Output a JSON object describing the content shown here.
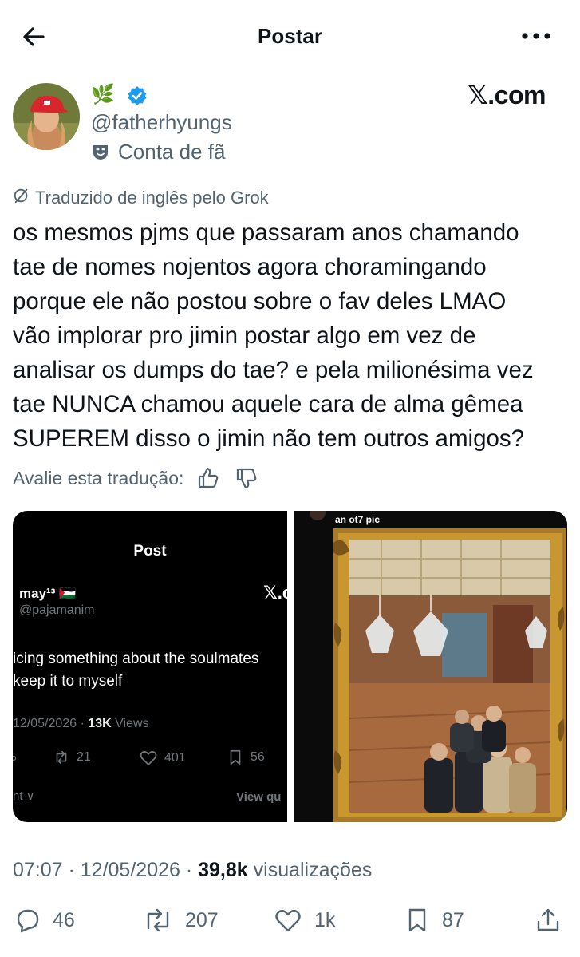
{
  "topbar": {
    "title": "Postar"
  },
  "author": {
    "emoji": "🌿",
    "handle": "@fatherhyungs",
    "account_label": "Conta de fã"
  },
  "source_label": "𝕏.com",
  "translation": {
    "label": "Traduzido de inglês pelo Grok",
    "rate_label": "Avalie esta tradução:"
  },
  "post_text": "os mesmos pjms que passaram anos chamando\ntae de nomes nojentos agora choramingando\nporque ele não postou sobre o fav deles LMAO\nvão implorar pro jimin postar algo em vez de\nanalisar os dumps do tae? e pela milionésima vez\ntae NUNCA chamou aquele cara de alma gêmea\nSUPEREM disso o jimin não tem outros amigos?",
  "media": {
    "left": {
      "title": "Post",
      "name": "may¹³ 🇵🇸",
      "handle": "@pajamanim",
      "x_mark": "𝕏.c",
      "body": "icing something about the soulmates\nkeep it to myself",
      "date": "12/05/2026 · ",
      "views_count": "13K",
      "views_label": " Views",
      "retweets": "21",
      "likes": "401",
      "bookmarks": "56",
      "footer_left": "nt ∨",
      "footer_right": "View qu"
    },
    "right": {
      "caption": "an ot7 pic"
    }
  },
  "meta": {
    "time_date": "07:07 · 12/05/2026 · ",
    "views_count": "39,8k",
    "views_label": " visualizações"
  },
  "actions": {
    "replies": "46",
    "reposts": "207",
    "likes": "1k",
    "bookmarks": "87"
  },
  "colors": {
    "verified": "#1d9bf0",
    "secondary_text": "#536471",
    "primary_text": "#0f1419"
  }
}
